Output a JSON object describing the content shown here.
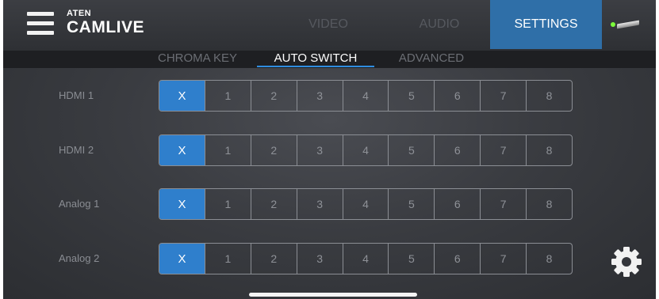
{
  "brand": {
    "small": "ATEN",
    "name": "CAMLIVE"
  },
  "main_tabs": [
    {
      "label": "VIDEO",
      "active": false
    },
    {
      "label": "AUDIO",
      "active": false
    },
    {
      "label": "SETTINGS",
      "active": true
    }
  ],
  "sub_tabs": [
    {
      "label": "CHROMA KEY",
      "active": false
    },
    {
      "label": "AUTO SWITCH",
      "active": true
    },
    {
      "label": "ADVANCED",
      "active": false
    }
  ],
  "device_status": {
    "led_color": "#7cff3a"
  },
  "options": [
    "X",
    "1",
    "2",
    "3",
    "4",
    "5",
    "6",
    "7",
    "8"
  ],
  "rows": [
    {
      "label": "HDMI 1",
      "selected": "X"
    },
    {
      "label": "HDMI 2",
      "selected": "X"
    },
    {
      "label": "Analog 1",
      "selected": "X"
    },
    {
      "label": "Analog 2",
      "selected": "X"
    }
  ],
  "colors": {
    "accent": "#2f7fcc",
    "settings_tab": "#2f6fa8"
  },
  "icons": {
    "menu": "hamburger-icon",
    "settings": "gear-icon",
    "device": "device-status-icon"
  }
}
